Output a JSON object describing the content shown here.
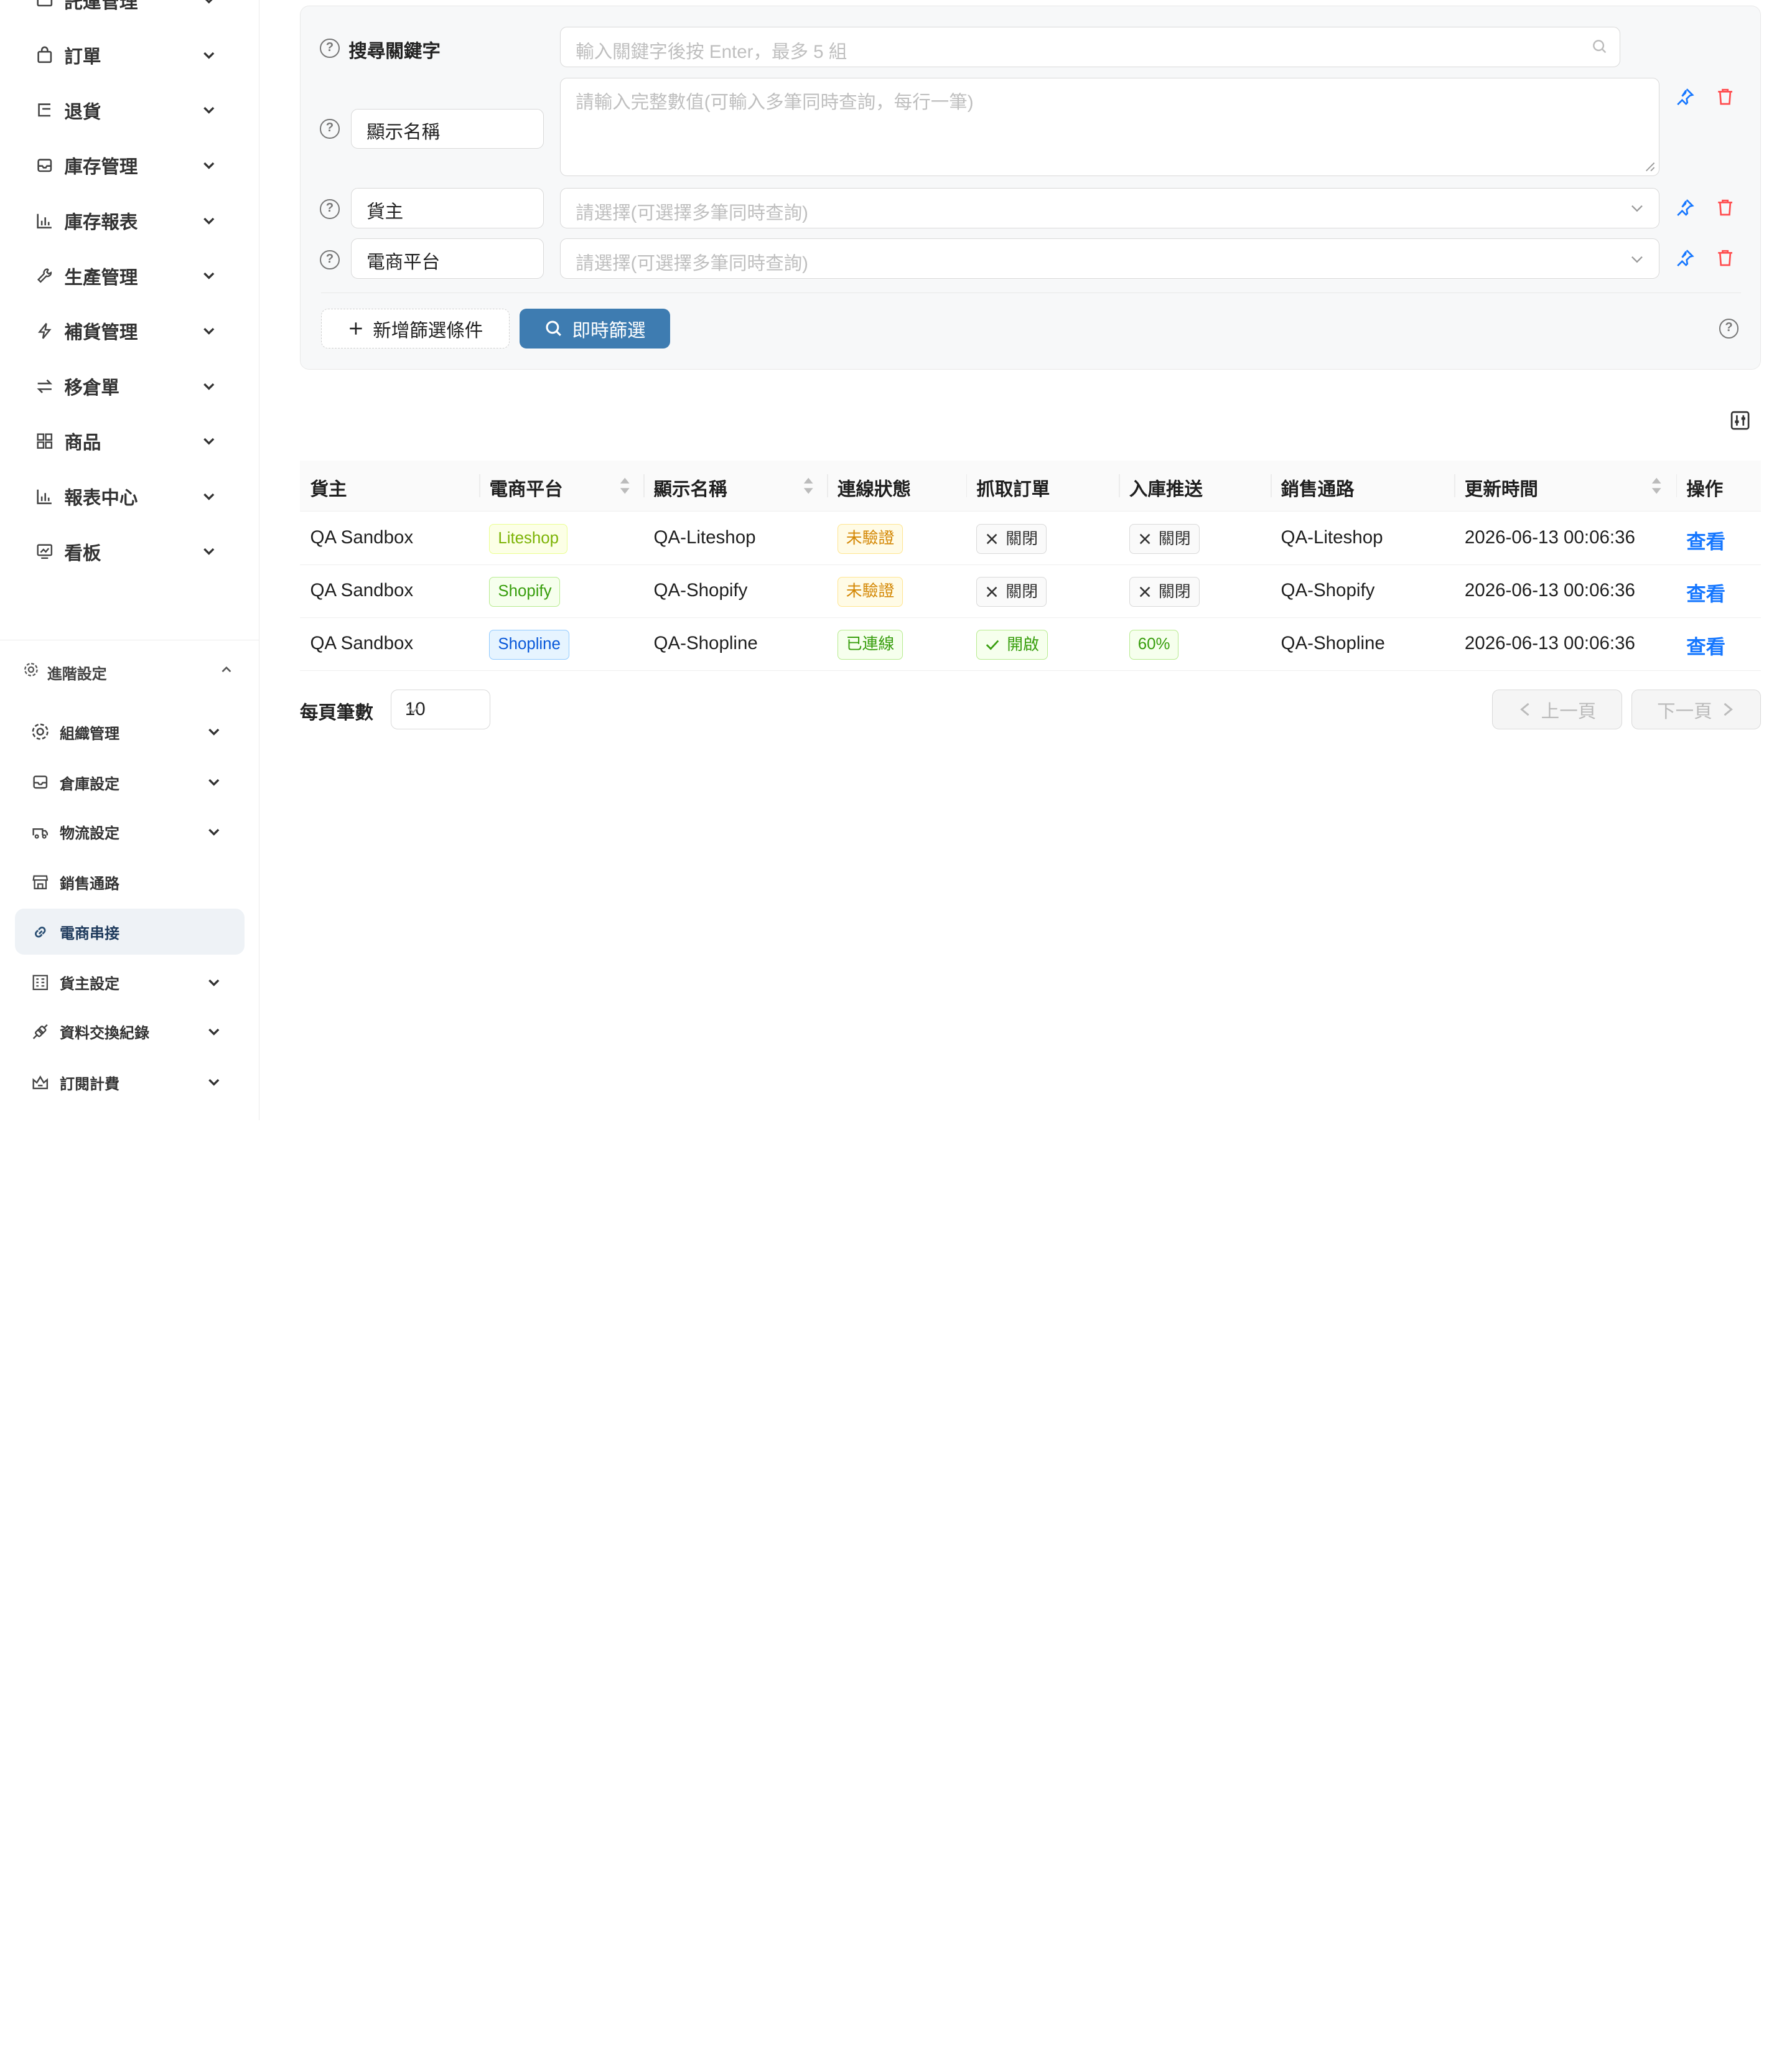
{
  "sidebar": {
    "top_partial_label": "託運管理",
    "items": [
      {
        "label": "訂單",
        "icon": "shopping-bag-icon"
      },
      {
        "label": "退貨",
        "icon": "return-icon"
      },
      {
        "label": "庫存管理",
        "icon": "inbox-icon"
      },
      {
        "label": "庫存報表",
        "icon": "bar-chart-icon"
      },
      {
        "label": "生產管理",
        "icon": "wrench-icon"
      },
      {
        "label": "補貨管理",
        "icon": "lightning-icon"
      },
      {
        "label": "移倉單",
        "icon": "swap-icon"
      },
      {
        "label": "商品",
        "icon": "grid-icon"
      },
      {
        "label": "報表中心",
        "icon": "bar-chart-icon"
      },
      {
        "label": "看板",
        "icon": "dashboard-icon"
      }
    ],
    "advanced": {
      "label": "進階設定",
      "items": [
        {
          "label": "組織管理",
          "icon": "gear-icon",
          "has_children": true
        },
        {
          "label": "倉庫設定",
          "icon": "inbox-icon",
          "has_children": true
        },
        {
          "label": "物流設定",
          "icon": "truck-icon",
          "has_children": true
        },
        {
          "label": "銷售通路",
          "icon": "store-icon",
          "has_children": false
        },
        {
          "label": "電商串接",
          "icon": "link-icon",
          "has_children": false,
          "active": true
        },
        {
          "label": "貨主設定",
          "icon": "layout-icon",
          "has_children": true
        },
        {
          "label": "資料交換紀錄",
          "icon": "api-icon",
          "has_children": true
        },
        {
          "label": "訂閱計費",
          "icon": "subscription-icon",
          "has_children": true
        }
      ]
    }
  },
  "filters": {
    "keyword_label": "搜尋關鍵字",
    "keyword_placeholder": "輸入關鍵字後按 Enter，最多 5 組",
    "rows": [
      {
        "field": "顯示名稱",
        "placeholder": "請輸入完整數值(可輸入多筆同時查詢，每行一筆)"
      },
      {
        "field": "貨主",
        "placeholder": "請選擇(可選擇多筆同時查詢)"
      },
      {
        "field": "電商平台",
        "placeholder": "請選擇(可選擇多筆同時查詢)"
      }
    ],
    "add_filter_label": "新增篩選條件",
    "instant_filter_label": "即時篩選"
  },
  "table": {
    "columns": [
      "貨主",
      "電商平台",
      "顯示名稱",
      "連線狀態",
      "抓取訂單",
      "入庫推送",
      "銷售通路",
      "更新時間",
      "操作"
    ],
    "rows": [
      {
        "owner": "QA Sandbox",
        "platform": "Liteshop",
        "name": "QA-Liteshop",
        "status": "未驗證",
        "fetch": "關閉",
        "push": "關閉",
        "channel": "QA-Liteshop",
        "updated": "2026-06-13 00:06:36",
        "action": "查看"
      },
      {
        "owner": "QA Sandbox",
        "platform": "Shopify",
        "name": "QA-Shopify",
        "status": "未驗證",
        "fetch": "關閉",
        "push": "關閉",
        "channel": "QA-Shopify",
        "updated": "2026-06-13 00:06:36",
        "action": "查看"
      },
      {
        "owner": "QA Sandbox",
        "platform": "Shopline",
        "name": "QA-Shopline",
        "status": "已連線",
        "fetch": "開啟",
        "push": "60%",
        "channel": "QA-Shopline",
        "updated": "2026-06-13 00:06:36",
        "action": "查看"
      }
    ]
  },
  "pagination": {
    "page_size_label": "每頁筆數",
    "page_size": "10",
    "prev_label": "上一頁",
    "next_label": "下一頁"
  },
  "colors": {
    "primary": "#3e7cb1",
    "link": "#1677ff",
    "danger": "#ff4d4f",
    "active_bg": "#eef2f6"
  }
}
